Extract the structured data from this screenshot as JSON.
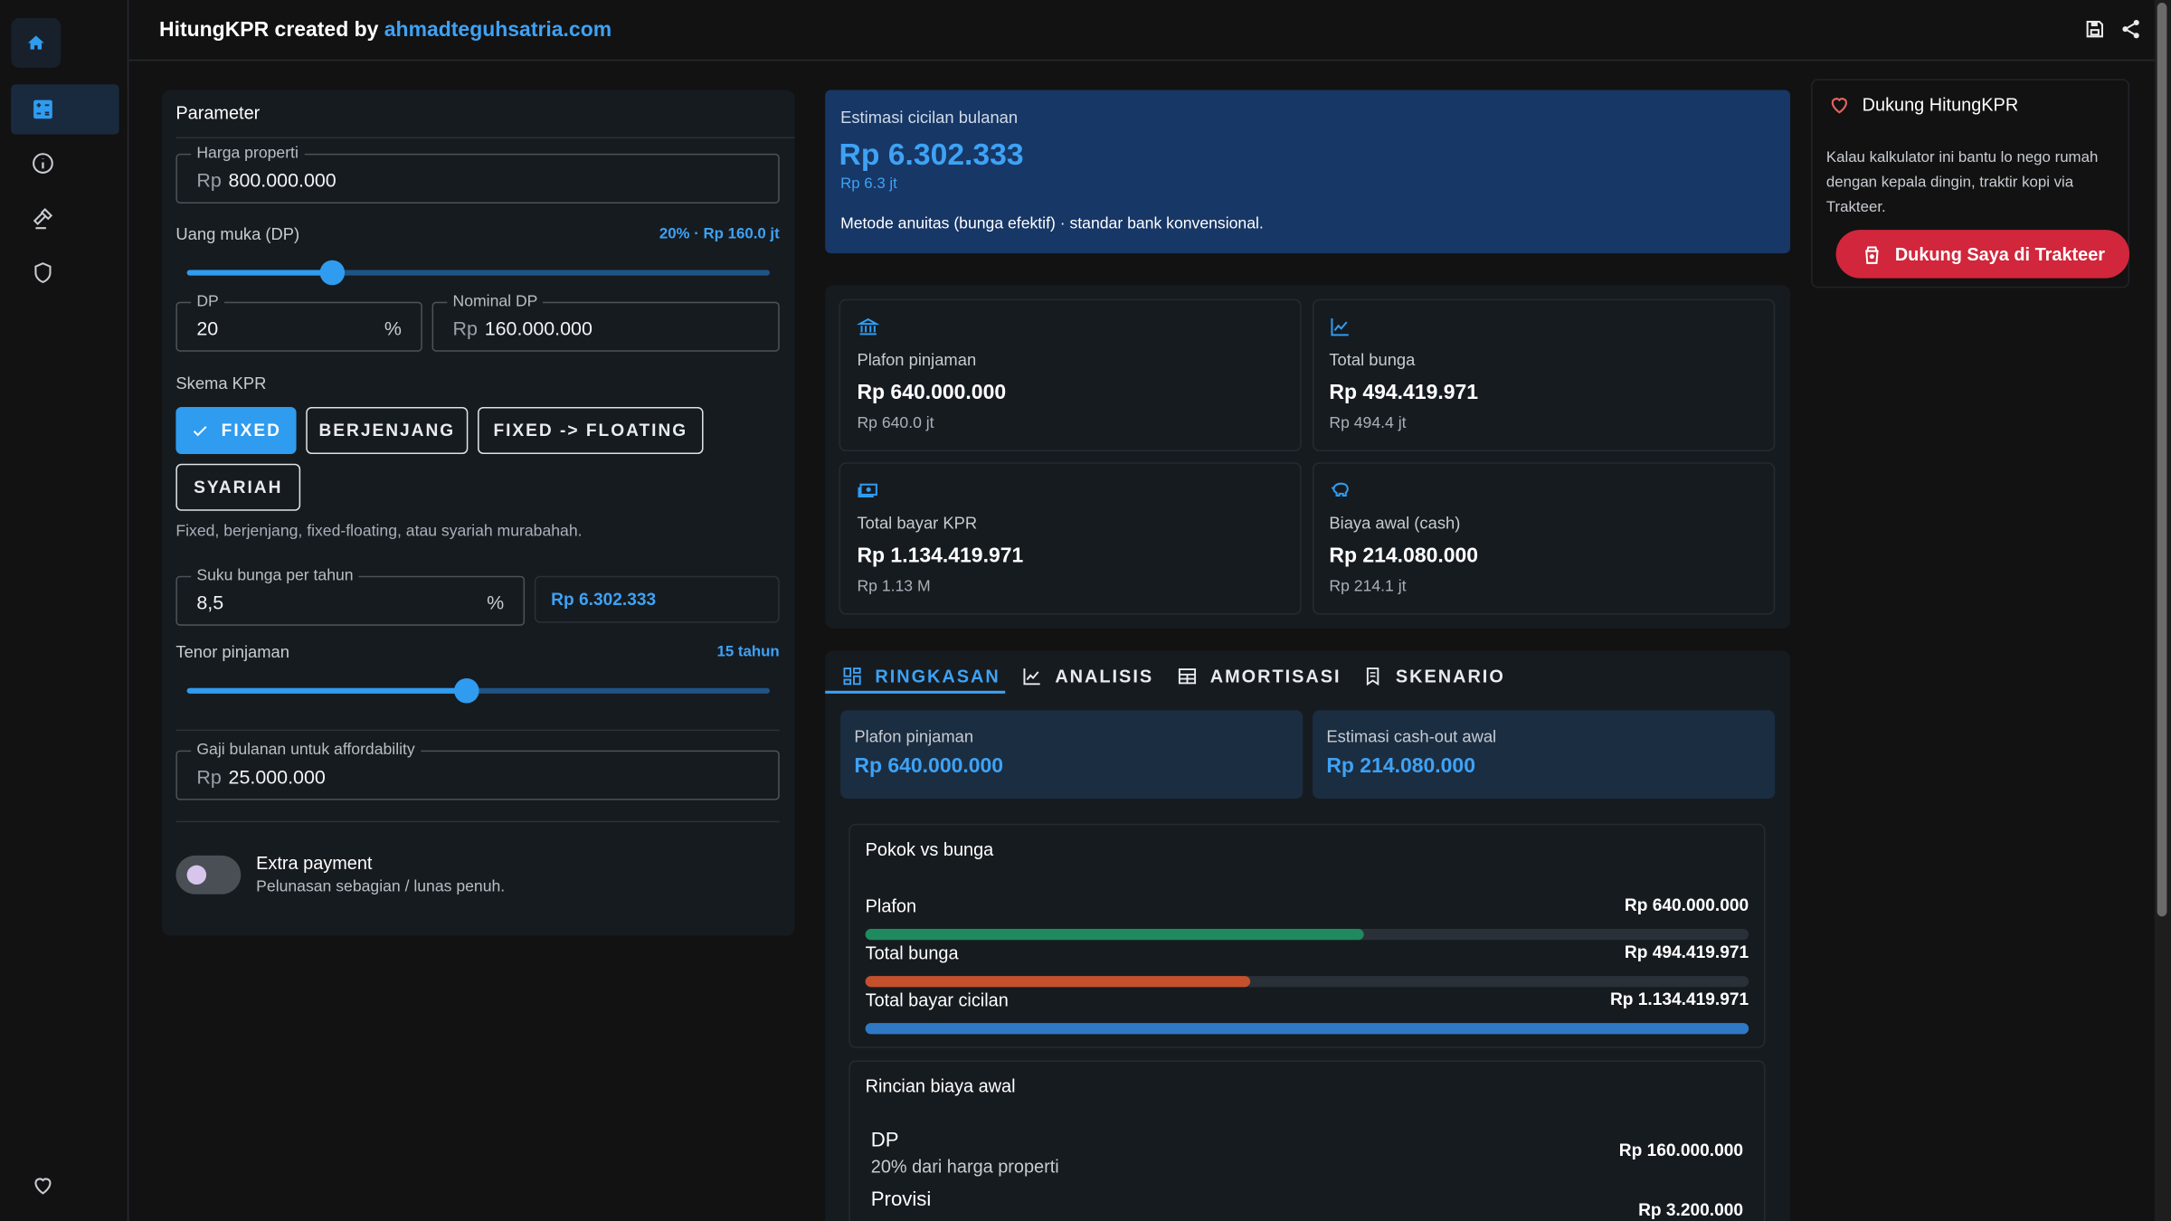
{
  "header": {
    "title_prefix": "HitungKPR created by",
    "title_link": "ahmadteguhsatria.com"
  },
  "sidebar": {
    "items": [
      "home-icon",
      "calculator-icon",
      "info-icon",
      "gavel-icon",
      "shield-icon",
      "heart-icon"
    ]
  },
  "parameters": {
    "title": "Parameter",
    "harga": {
      "legend": "Harga properti",
      "prefix": "Rp",
      "value": "800.000.000"
    },
    "dp_label": "Uang muka (DP)",
    "dp_badge": "20% · Rp 160.0 jt",
    "dp_slider_fraction": 0.25,
    "dp_percent": {
      "legend": "DP",
      "value": "20",
      "suffix": "%"
    },
    "dp_nominal": {
      "legend": "Nominal DP",
      "prefix": "Rp",
      "value": "160.000.000"
    },
    "skema_label": "Skema KPR",
    "skema_options": [
      "FIXED",
      "BERJENJANG",
      "FIXED -> FLOATING",
      "SYARIAH"
    ],
    "skema_selected": "FIXED",
    "skema_help": "Fixed, berjenjang, fixed-floating, atau syariah murabahah.",
    "bunga": {
      "legend": "Suku bunga per tahun",
      "value": "8,5",
      "suffix": "%"
    },
    "bunga_cicilan": "Rp 6.302.333",
    "tenor_label": "Tenor pinjaman",
    "tenor_badge": "15 tahun",
    "tenor_slider_fraction": 0.48,
    "gaji": {
      "legend": "Gaji bulanan untuk affordability",
      "prefix": "Rp",
      "value": "25.000.000"
    },
    "extra_title": "Extra payment",
    "extra_sub": "Pelunasan sebagian / lunas penuh.",
    "extra_on": false
  },
  "estimate": {
    "label": "Estimasi cicilan bulanan",
    "value": "Rp 6.302.333",
    "short": "Rp 6.3 jt",
    "method": "Metode anuitas (bunga efektif) · standar bank konvensional."
  },
  "stats": [
    {
      "icon": "bank-icon",
      "label": "Plafon pinjaman",
      "value": "Rp 640.000.000",
      "sub": "Rp 640.0 jt"
    },
    {
      "icon": "trend-icon",
      "label": "Total bunga",
      "value": "Rp 494.419.971",
      "sub": "Rp 494.4 jt"
    },
    {
      "icon": "cash-icon",
      "label": "Total bayar KPR",
      "value": "Rp 1.134.419.971",
      "sub": "Rp 1.13 M"
    },
    {
      "icon": "piggy-icon",
      "label": "Biaya awal (cash)",
      "value": "Rp 214.080.000",
      "sub": "Rp 214.1 jt"
    }
  ],
  "tabs": [
    "RINGKASAN",
    "ANALISIS",
    "AMORTISASI",
    "SKENARIO"
  ],
  "summary": {
    "plafon_label": "Plafon pinjaman",
    "plafon_value": "Rp 640.000.000",
    "cashout_label": "Estimasi cash-out awal",
    "cashout_value": "Rp 214.080.000"
  },
  "pokok_vs_bunga": {
    "title": "Pokok vs bunga",
    "rows": [
      {
        "label": "Plafon",
        "value": "Rp 640.000.000",
        "fraction": 0.564,
        "color": "#1f8a5e"
      },
      {
        "label": "Total bunga",
        "value": "Rp 494.419.971",
        "fraction": 0.436,
        "color": "#c4502c"
      },
      {
        "label": "Total bayar cicilan",
        "value": "Rp 1.134.419.971",
        "fraction": 1.0,
        "color": "#2f78c4"
      }
    ]
  },
  "rincian": {
    "title": "Rincian biaya awal",
    "rows": [
      {
        "label": "DP",
        "sub": "20% dari harga properti",
        "value": "Rp 160.000.000"
      },
      {
        "label": "Provisi",
        "sub": "",
        "value": "Rp 3.200.000"
      }
    ]
  },
  "support": {
    "title": "Dukung HitungKPR",
    "text": "Kalau kalkulator ini bantu lo nego rumah dengan kepala dingin, traktir kopi via Trakteer.",
    "button": "Dukung Saya di Trakteer"
  },
  "colors": {
    "accent": "#2f9cf0",
    "support": "#d1263b",
    "estimate_bg": "#173766"
  }
}
